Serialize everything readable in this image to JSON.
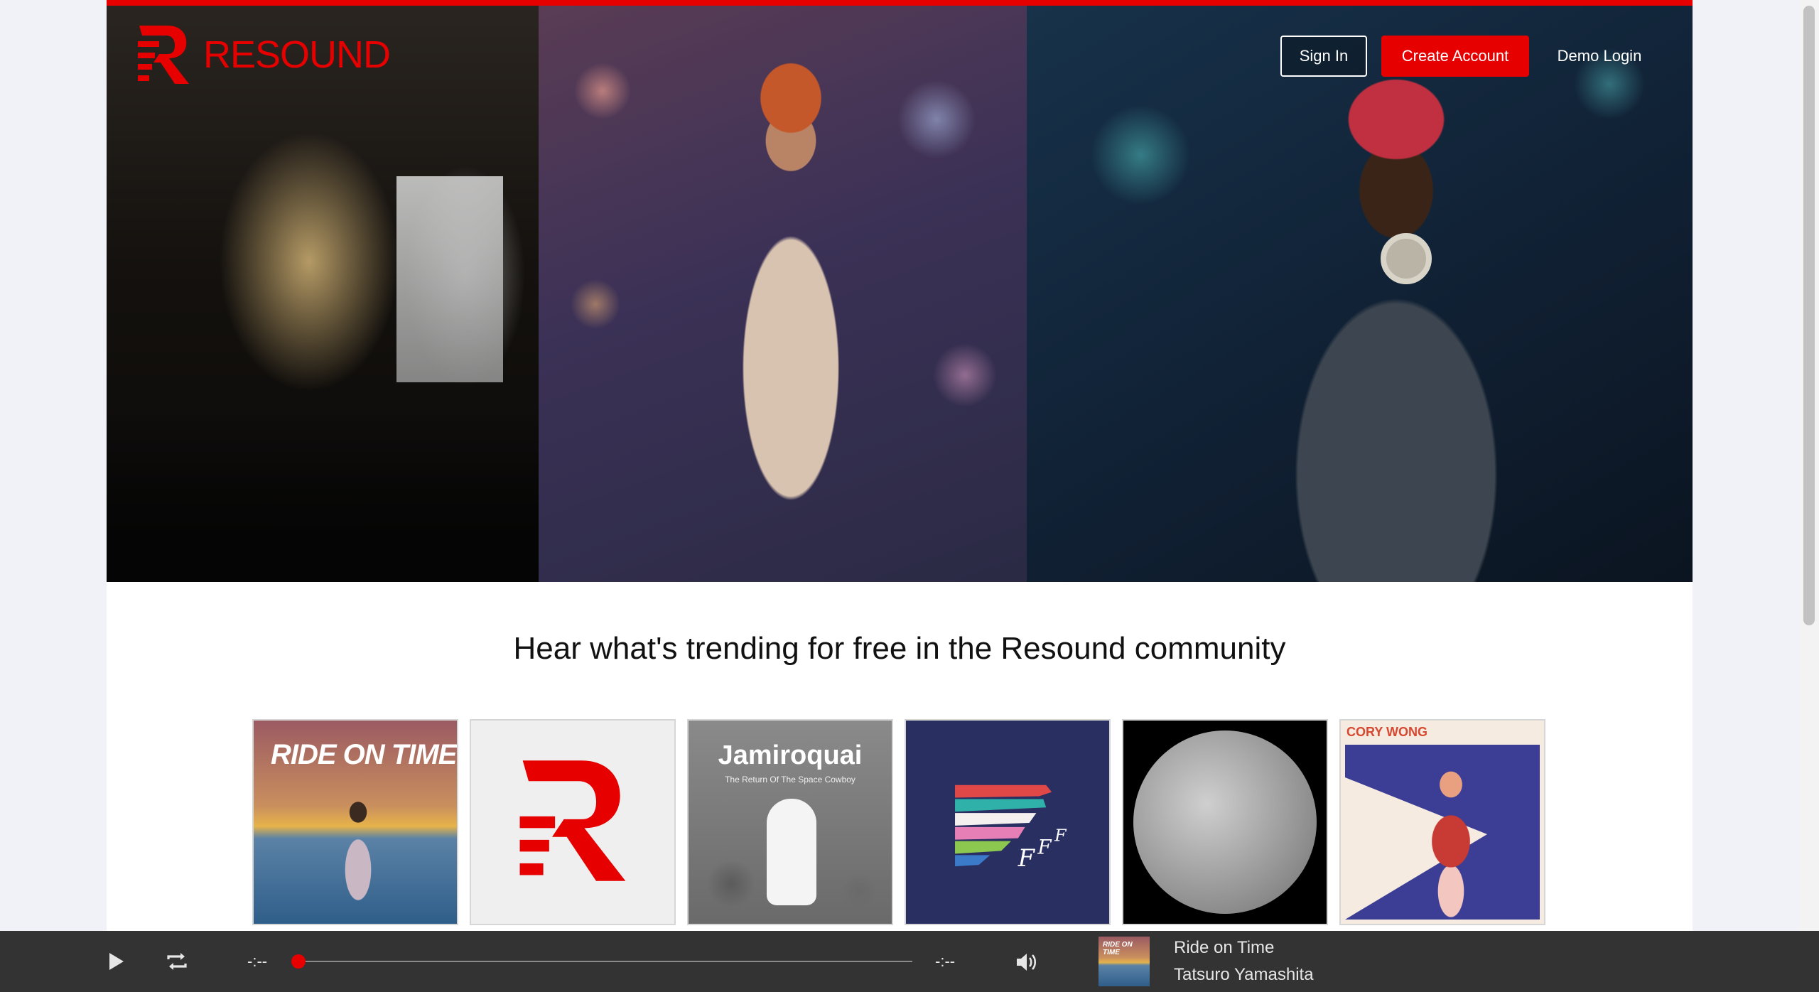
{
  "brand": {
    "name": "RESOUND",
    "accent": "#e60000"
  },
  "nav": {
    "sign_in": "Sign In",
    "create_account": "Create Account",
    "demo_login": "Demo Login"
  },
  "icons": {
    "logo": "resound-logo-icon",
    "play": "play-icon",
    "repeat": "repeat-icon",
    "volume": "volume-icon"
  },
  "trending": {
    "title": "Hear what's trending for free in the Resound community",
    "albums": [
      {
        "art_text": "RIDE ON TIME"
      },
      {
        "art_text": ""
      },
      {
        "art_text": "Jamiroquai",
        "art_subtext": "The Return Of The Space Cowboy"
      },
      {
        "art_text": ""
      },
      {
        "art_text": ""
      },
      {
        "art_text": "CORY WONG"
      }
    ]
  },
  "player": {
    "current_time": "-:--",
    "duration": "-:--",
    "progress": 0,
    "now_playing_title": "Ride on Time",
    "now_playing_artist": "Tatsuro Yamashita",
    "thumb_text": "RIDE ON TIME"
  }
}
